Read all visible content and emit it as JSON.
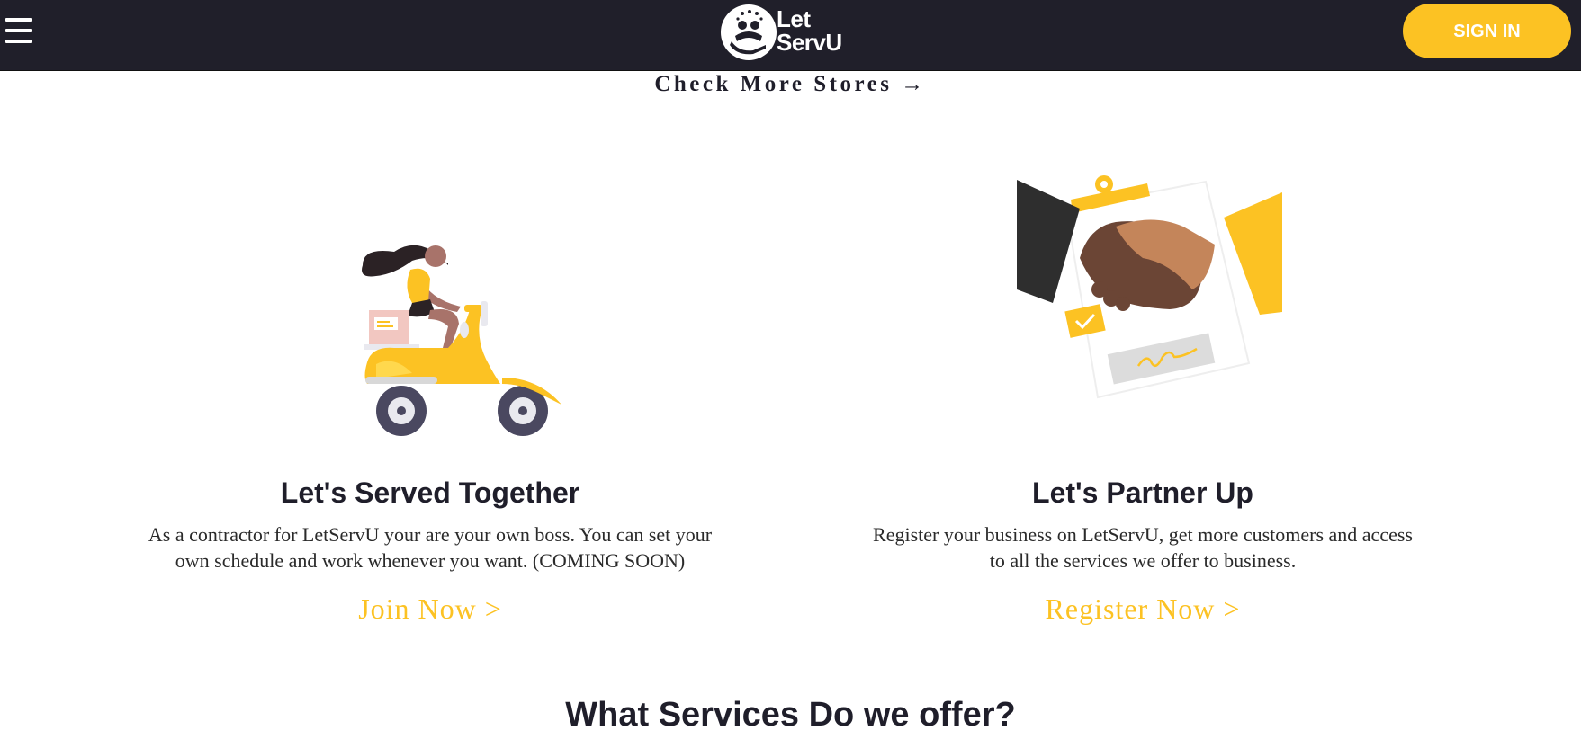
{
  "header": {
    "menu_icon": "hamburger-menu-icon",
    "logo": {
      "line1": "Let",
      "line2": "ServU",
      "icon": "hand-people-logo-icon"
    },
    "signin_label": "SIGN IN"
  },
  "check_more": {
    "label": "Check More Stores →"
  },
  "cards": [
    {
      "illustration": "delivery-scooter-illustration",
      "title": "Let's Served Together",
      "desc_line1": "As a contractor for LetServU your are your own boss. You can set your",
      "desc_line2": "own schedule and work whenever you want. (COMING SOON)",
      "link": "Join Now >"
    },
    {
      "illustration": "handshake-contract-illustration",
      "title": "Let's Partner Up",
      "desc_line1": "Register your business on LetServU, get more customers and access",
      "desc_line2": "to all the services we offer to business.",
      "link": "Register Now >"
    }
  ],
  "services": {
    "title": "What Services Do we offer?"
  },
  "colors": {
    "header_bg": "#201f2a",
    "accent": "#fcc223",
    "text": "#1f1e2a"
  }
}
